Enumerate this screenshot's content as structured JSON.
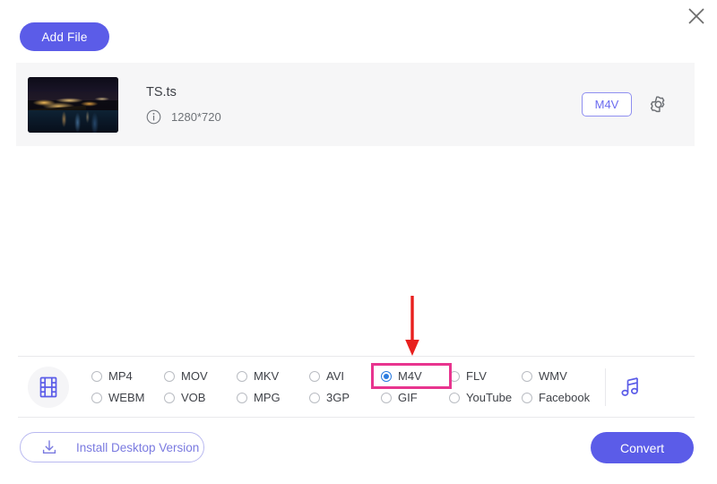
{
  "window": {
    "close_label": "×"
  },
  "toolbar": {
    "add_file_label": "Add File"
  },
  "file": {
    "name": "TS.ts",
    "dimensions": "1280*720",
    "output_format_badge": "M4V",
    "thumbnail_alt": "night-city-harbor-thumbnail"
  },
  "format_bar": {
    "video_group_icon": "film-icon",
    "audio_group_icon": "music-note-icon",
    "selected_format": "M4V",
    "options": [
      {
        "label": "MP4",
        "selected": false
      },
      {
        "label": "MOV",
        "selected": false
      },
      {
        "label": "MKV",
        "selected": false
      },
      {
        "label": "AVI",
        "selected": false
      },
      {
        "label": "M4V",
        "selected": true
      },
      {
        "label": "FLV",
        "selected": false
      },
      {
        "label": "WMV",
        "selected": false
      },
      {
        "label": "WEBM",
        "selected": false
      },
      {
        "label": "VOB",
        "selected": false
      },
      {
        "label": "MPG",
        "selected": false
      },
      {
        "label": "3GP",
        "selected": false
      },
      {
        "label": "GIF",
        "selected": false
      },
      {
        "label": "YouTube",
        "selected": false
      },
      {
        "label": "Facebook",
        "selected": false
      }
    ]
  },
  "footer": {
    "install_label": "Install Desktop Version",
    "convert_label": "Convert"
  },
  "annotations": {
    "arrow_color": "#e8201e",
    "highlight_color": "#e8358f",
    "arrow_target": "M4V"
  },
  "colors": {
    "accent": "#5b5ce8",
    "badge_border": "#8f8ff0",
    "card_bg": "#f6f6f7",
    "radio_selected": "#2b7ce0"
  }
}
